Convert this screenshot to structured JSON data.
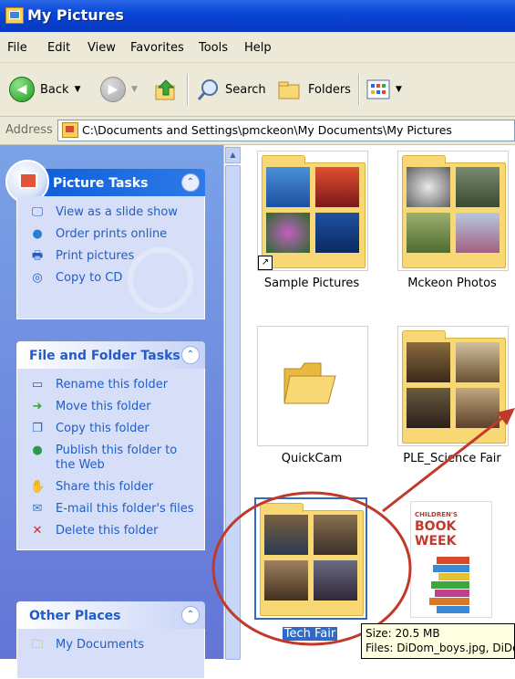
{
  "window": {
    "title": "My Pictures"
  },
  "menubar": {
    "items": [
      "File",
      "Edit",
      "View",
      "Favorites",
      "Tools",
      "Help"
    ]
  },
  "toolbar": {
    "back_label": "Back",
    "search_label": "Search",
    "folders_label": "Folders"
  },
  "address": {
    "label": "Address",
    "path": "C:\\Documents and Settings\\pmckeon\\My Documents\\My Pictures"
  },
  "taskpane": {
    "picture_tasks": {
      "title": "Picture Tasks",
      "items": [
        "View as a slide show",
        "Order prints online",
        "Print pictures",
        "Copy to CD"
      ]
    },
    "file_folder_tasks": {
      "title": "File and Folder Tasks",
      "items": [
        "Rename this folder",
        "Move this folder",
        "Copy this folder",
        "Publish this folder to the Web",
        "Share this folder",
        "E-mail this folder's files",
        "Delete this folder"
      ]
    },
    "other_places": {
      "title": "Other Places",
      "items": [
        "My Documents"
      ]
    }
  },
  "folders": [
    {
      "name": "Sample Pictures"
    },
    {
      "name": "Mckeon Photos"
    },
    {
      "name": "QuickCam"
    },
    {
      "name": "PLE_Science Fair"
    },
    {
      "name": "Tech Fair"
    },
    {
      "name": ""
    }
  ],
  "book": {
    "line1": "CHILDREN'S",
    "line2": "BOOK",
    "line3": "WEEK"
  },
  "tooltip": {
    "size": "Size: 20.5 MB",
    "files": "Files: DiDom_boys.jpg, DiDo"
  },
  "colors": {
    "selection": "#316ac5",
    "annotation": "#c0392b",
    "titlebar": "#0a46d6"
  }
}
